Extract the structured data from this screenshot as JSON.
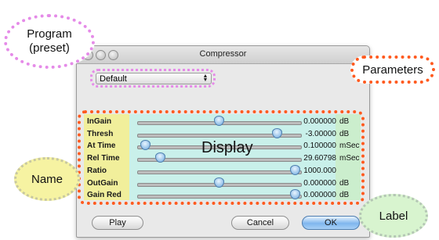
{
  "window": {
    "title": "Compressor"
  },
  "preset": {
    "selected": "Default"
  },
  "parameters": [
    {
      "name": "InGain",
      "value": "0.000000",
      "unit": "dB",
      "level": 0.5
    },
    {
      "name": "Thresh",
      "value": "-3.00000",
      "unit": "dB",
      "level": 0.88
    },
    {
      "name": "At Time",
      "value": "0.100000",
      "unit": "mSec",
      "level": 0.02
    },
    {
      "name": "Rel Time",
      "value": "29.60798",
      "unit": "mSec",
      "level": 0.12
    },
    {
      "name": "Ratio",
      "value": "1000.000",
      "unit": "",
      "level": 1.0
    },
    {
      "name": "OutGain",
      "value": "0.000000",
      "unit": "dB",
      "level": 0.5
    },
    {
      "name": "Gain Red",
      "value": "0.000000",
      "unit": "dB",
      "level": 1.0
    }
  ],
  "buttons": {
    "play": "Play",
    "cancel": "Cancel",
    "ok": "OK"
  },
  "annotations": {
    "program": "Program\n(preset)",
    "parameters": "Parameters",
    "display": "Display",
    "name": "Name",
    "label": "Label"
  },
  "colors": {
    "program_outline": "#e58be8",
    "parameters_outline": "#ff5a1f",
    "name_fill": "#f1ef9b",
    "display_fill": "#c9f0ea",
    "label_fill": "#cbeecd"
  }
}
